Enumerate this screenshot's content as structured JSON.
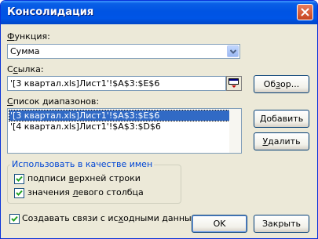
{
  "dialog": {
    "title": "Консолидация",
    "function_label_pre": "",
    "function_label_u": "Ф",
    "function_label_post": "ункция:",
    "function_value": "Сумма",
    "ref_label_pre": "С",
    "ref_label_u": "с",
    "ref_label_post": "ылка:",
    "ref_value": "'[3 квартал.xls]Лист1'!$A$3:$E$6",
    "ranges_label_pre": "",
    "ranges_label_u": "С",
    "ranges_label_post": "писок диапазонов:",
    "ranges": [
      "'[3 квартал.xls]Лист1'!$A$3:$E$6",
      "'[4 квартал.xls]Лист1'!$A$3:$D$6"
    ],
    "browse_pre": "Об",
    "browse_u": "з",
    "browse_post": "ор...",
    "add_pre": "",
    "add_u": "Д",
    "add_post": "обавить",
    "delete_pre": "",
    "delete_u": "У",
    "delete_post": "далить",
    "group_title": "Использовать в качестве имен",
    "top_row_pre": "подписи ",
    "top_row_u": "в",
    "top_row_post": "ерхней строки",
    "left_col_pre": "значения ",
    "left_col_u": "л",
    "left_col_post": "евого столбца",
    "links_pre": "Создавать связи с ис",
    "links_u": "х",
    "links_post": "одными данными",
    "ok_label": "OK",
    "close_label": "Закрыть",
    "checkboxes": {
      "top_row": true,
      "left_col": true,
      "links": true
    }
  }
}
